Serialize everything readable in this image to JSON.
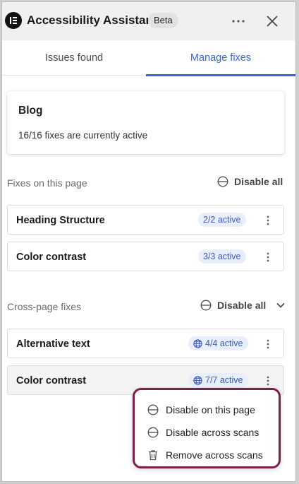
{
  "header": {
    "title": "Accessibility Assistant",
    "badge": "Beta",
    "icons": {
      "logo": "elementor-logo-icon",
      "more": "more-horizontal-icon",
      "close": "close-icon"
    }
  },
  "tabs": [
    {
      "label": "Issues found",
      "active": false
    },
    {
      "label": "Manage fixes",
      "active": true
    }
  ],
  "summary": {
    "title": "Blog",
    "subtitle": "16/16 fixes are currently active"
  },
  "page_fixes": {
    "label": "Fixes on this page",
    "disable_all": "Disable all",
    "items": [
      {
        "name": "Heading Structure",
        "status": "2/2 active"
      },
      {
        "name": "Color contrast",
        "status": "3/3 active"
      }
    ]
  },
  "cross_page_fixes": {
    "label": "Cross-page fixes",
    "disable_all": "Disable all",
    "items": [
      {
        "name": "Alternative text",
        "status": "4/4 active"
      },
      {
        "name": "Color contrast",
        "status": "7/7 active"
      }
    ]
  },
  "menu": {
    "items": [
      {
        "label": "Disable on this page",
        "icon": "disable-icon"
      },
      {
        "label": "Disable across scans",
        "icon": "disable-icon"
      },
      {
        "label": "Remove across scans",
        "icon": "trash-icon"
      }
    ]
  },
  "colors": {
    "accent": "#3a66d6",
    "badge_bg": "#e9eefb",
    "badge_text": "#3b5bb8",
    "menu_border": "#7a1e4a"
  }
}
